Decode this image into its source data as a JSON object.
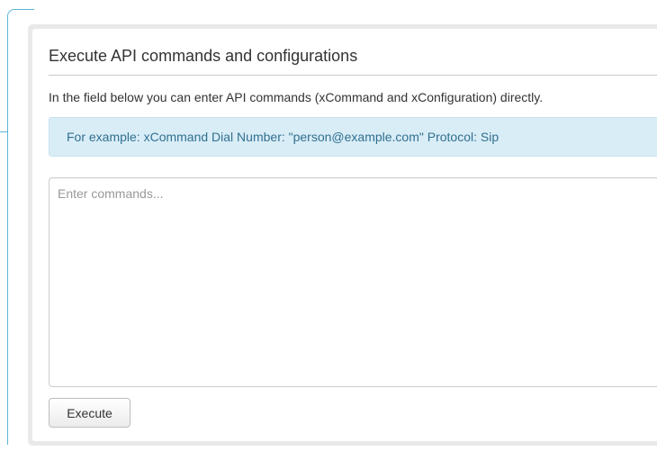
{
  "panel": {
    "title": "Execute API commands and configurations",
    "description": "In the field below you can enter API commands (xCommand and xConfiguration) directly.",
    "example": "For example: xCommand Dial Number: \"person@example.com\" Protocol: Sip",
    "command_input": {
      "value": "",
      "placeholder": "Enter commands..."
    },
    "execute_label": "Execute"
  },
  "colors": {
    "accent_bracket": "#5bb4d8",
    "info_background": "#d9edf7",
    "info_text": "#31708f"
  }
}
